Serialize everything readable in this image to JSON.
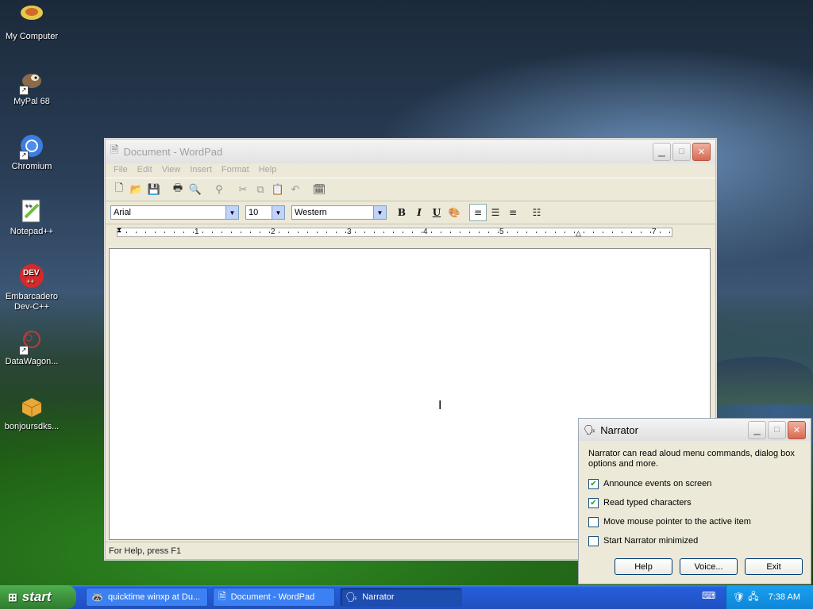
{
  "desktop": {
    "icons": [
      {
        "label": "My Computer",
        "icon": "my-computer-icon",
        "shortcut": false
      },
      {
        "label": "MyPal 68",
        "icon": "mypal-icon",
        "shortcut": true
      },
      {
        "label": "Chromium",
        "icon": "chromium-icon",
        "shortcut": true
      },
      {
        "label": "Notepad++",
        "icon": "notepadpp-icon",
        "shortcut": false
      },
      {
        "label": "Embarcadero Dev-C++",
        "icon": "devcpp-icon",
        "shortcut": false
      },
      {
        "label": "DataWagon...",
        "icon": "datawagon-icon",
        "shortcut": true
      },
      {
        "label": "bonjoursdks...",
        "icon": "package-icon",
        "shortcut": false
      }
    ]
  },
  "wordpad": {
    "title": "Document - WordPad",
    "menu": [
      "File",
      "Edit",
      "View",
      "Insert",
      "Format",
      "Help"
    ],
    "font": "Arial",
    "size": "10",
    "script": "Western",
    "bold": "B",
    "italic": "I",
    "underline": "U",
    "ruler_numbers": [
      "1",
      "2",
      "3",
      "4",
      "5",
      "7"
    ],
    "status": "For Help, press F1"
  },
  "narrator": {
    "title": "Narrator",
    "description": "Narrator can read aloud menu commands, dialog box options and more.",
    "options": [
      {
        "label": "Announce events on screen",
        "checked": true
      },
      {
        "label": "Read typed characters",
        "checked": true
      },
      {
        "label": "Move mouse pointer to the active item",
        "checked": false
      },
      {
        "label": "Start Narrator minimized",
        "checked": false
      }
    ],
    "buttons": {
      "help": "Help",
      "voice": "Voice...",
      "exit": "Exit"
    }
  },
  "taskbar": {
    "start": "start",
    "tasks": [
      {
        "label": "quicktime winxp at Du...",
        "active": false
      },
      {
        "label": "Document - WordPad",
        "active": false
      },
      {
        "label": "Narrator",
        "active": true
      }
    ],
    "clock": "7:38 AM"
  },
  "colors": {
    "taskbar": "#245edb",
    "start": "#3a8f3a",
    "tray": "#0f86d8"
  }
}
